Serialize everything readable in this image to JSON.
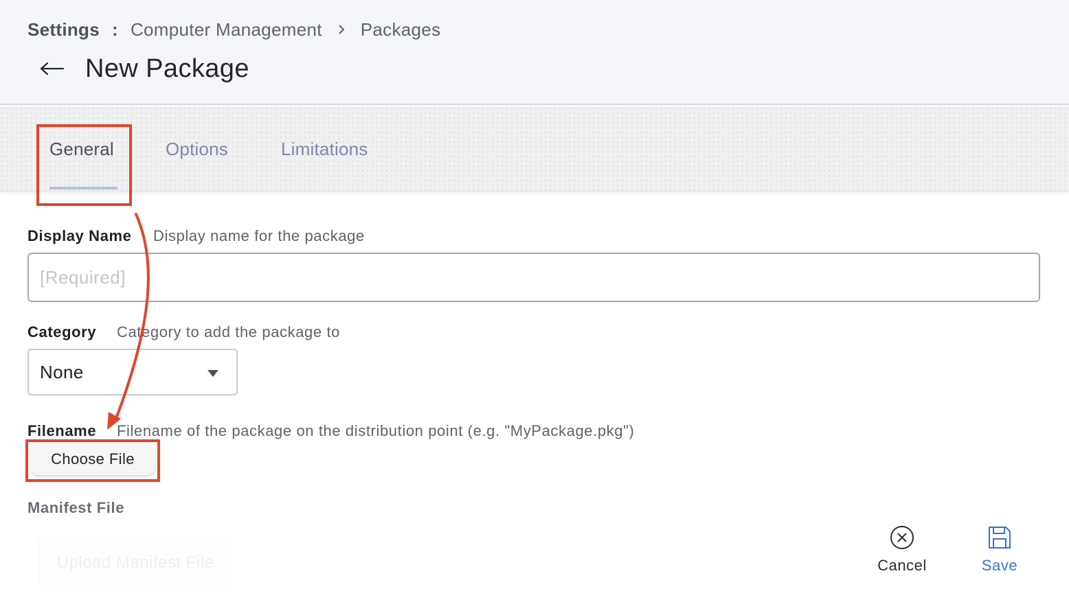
{
  "breadcrumb": {
    "root": "Settings",
    "separator": ":",
    "items": [
      "Computer Management",
      "Packages"
    ]
  },
  "header": {
    "title": "New Package",
    "back_icon": "arrow-left-icon"
  },
  "tabs": [
    {
      "label": "General",
      "active": true
    },
    {
      "label": "Options",
      "active": false
    },
    {
      "label": "Limitations",
      "active": false
    }
  ],
  "form": {
    "display_name": {
      "label": "Display Name",
      "help": "Display name for the package",
      "placeholder": "[Required]",
      "value": ""
    },
    "category": {
      "label": "Category",
      "help": "Category to add the package to",
      "selected": "None"
    },
    "filename": {
      "label": "Filename",
      "help": "Filename of the package on the distribution point (e.g. \"MyPackage.pkg\")",
      "button_label": "Choose File"
    },
    "manifest": {
      "label": "Manifest File",
      "button_label": "Upload Manifest File"
    }
  },
  "actions": {
    "cancel": {
      "label": "Cancel",
      "icon": "close-circle-icon"
    },
    "save": {
      "label": "Save",
      "icon": "floppy-disk-icon"
    }
  },
  "colors": {
    "highlight": "#e0452f",
    "save_accent": "#3a73c8",
    "tab_inactive": "#7d87a8",
    "tab_underline": "#b4bfd9"
  }
}
